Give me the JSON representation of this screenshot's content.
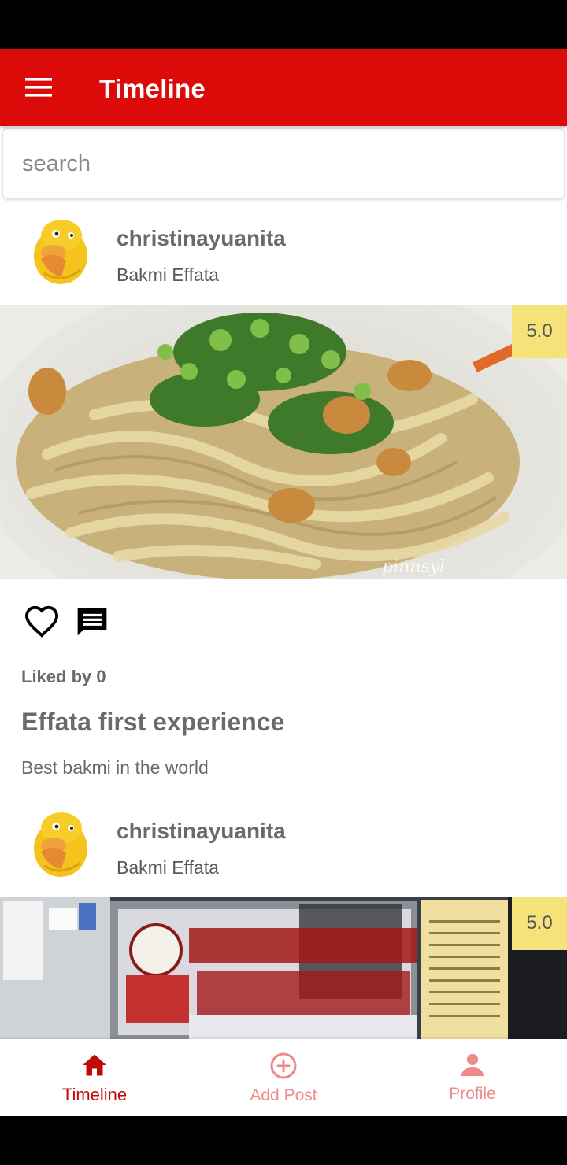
{
  "app_bar": {
    "title": "Timeline",
    "menu_icon": "menu-icon"
  },
  "search": {
    "placeholder": "search",
    "value": ""
  },
  "posts": [
    {
      "username": "christinayuanita",
      "place": "Bakmi Effata",
      "rating": "5.0",
      "photo_watermark": "pinnsyl",
      "liked_text": "Liked by 0",
      "title": "Effata first experience",
      "description": "Best bakmi in the world"
    },
    {
      "username": "christinayuanita",
      "place": "Bakmi Effata",
      "rating": "5.0"
    }
  ],
  "bottom_nav": {
    "items": [
      {
        "label": "Timeline",
        "icon": "home-icon",
        "active": true
      },
      {
        "label": "Add Post",
        "icon": "add-circle-icon",
        "active": false
      },
      {
        "label": "Profile",
        "icon": "person-icon",
        "active": false
      }
    ]
  },
  "colors": {
    "primary": "#dd0a0a",
    "rating_bg": "#f5e27a",
    "nav_inactive": "#ef8a8a"
  }
}
